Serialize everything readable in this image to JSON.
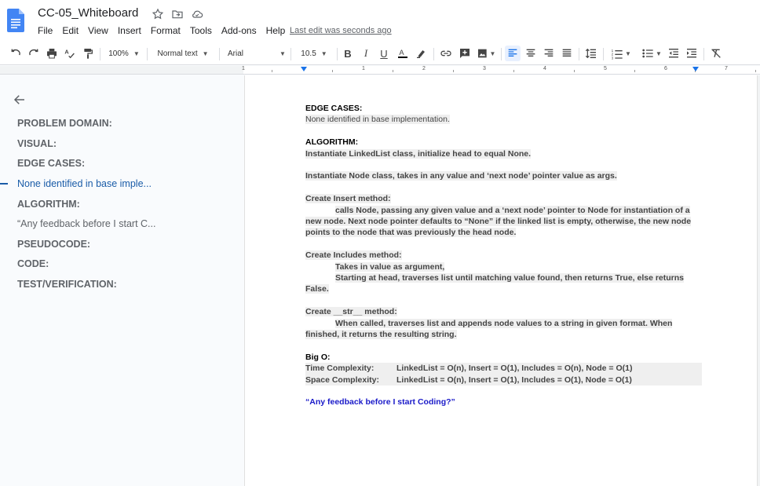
{
  "app": {
    "title": "CC-05_Whiteboard",
    "last_edit": "Last edit was seconds ago"
  },
  "menu": [
    "File",
    "Edit",
    "View",
    "Insert",
    "Format",
    "Tools",
    "Add-ons",
    "Help"
  ],
  "toolbar": {
    "zoom": "100%",
    "style": "Normal text",
    "font": "Arial",
    "font_size": "10.5"
  },
  "ruler": [
    "1",
    "1",
    "2",
    "3",
    "4",
    "5",
    "6",
    "7"
  ],
  "outline": {
    "items": [
      {
        "label": "PROBLEM DOMAIN:",
        "state": "heading"
      },
      {
        "label": "VISUAL:",
        "state": "heading"
      },
      {
        "label": "EDGE CASES:",
        "state": "heading"
      },
      {
        "label": "None identified in base imple...",
        "state": "active"
      },
      {
        "label": "ALGORITHM:",
        "state": "heading"
      },
      {
        "label": "“Any feedback before I start C...",
        "state": "normal"
      },
      {
        "label": "PSEUDOCODE:",
        "state": "heading"
      },
      {
        "label": "CODE:",
        "state": "heading"
      },
      {
        "label": "TEST/VERIFICATION:",
        "state": "heading"
      }
    ]
  },
  "document": {
    "edge_heading": "EDGE CASES:",
    "edge_text": "None identified in base implementation.",
    "algo_heading": "ALGORITHM:",
    "algo_1": "Instantiate LinkedList class, initialize head to equal None.",
    "algo_2": "Instantiate  Node class, takes in any value and  ‘next node’ pointer value as args.",
    "insert_title": "Create Insert method:",
    "insert_line1": "calls Node, passing any given value and a ‘next node’ pointer to Node for instantiation of a",
    "insert_line2": "new node. Next node pointer defaults to “None” if the linked list is empty, otherwise, the new node",
    "insert_line3": "points to the node that was previously the head node.",
    "includes_title": "Create Includes method:",
    "includes_line1": "Takes in value as argument,",
    "includes_line2": "Starting at head, traverses list until matching value found, then returns True, else returns",
    "includes_line3": "False.",
    "str_title": "Create __str__ method:",
    "str_line1": "When called, traverses list and appends node values to a string in given format. When",
    "str_line2": "finished, it returns the resulting string.",
    "bigo_heading": "Big O:",
    "time_label": "Time Complexity:",
    "time_value": "LinkedList = O(n), Insert = O(1), Includes = O(n), Node = O(1)",
    "space_label": "Space Complexity:",
    "space_value": "LinkedList = O(n), Insert = O(1), Includes = O(1), Node = O(1)",
    "feedback": "“Any feedback before I start Coding?”"
  }
}
